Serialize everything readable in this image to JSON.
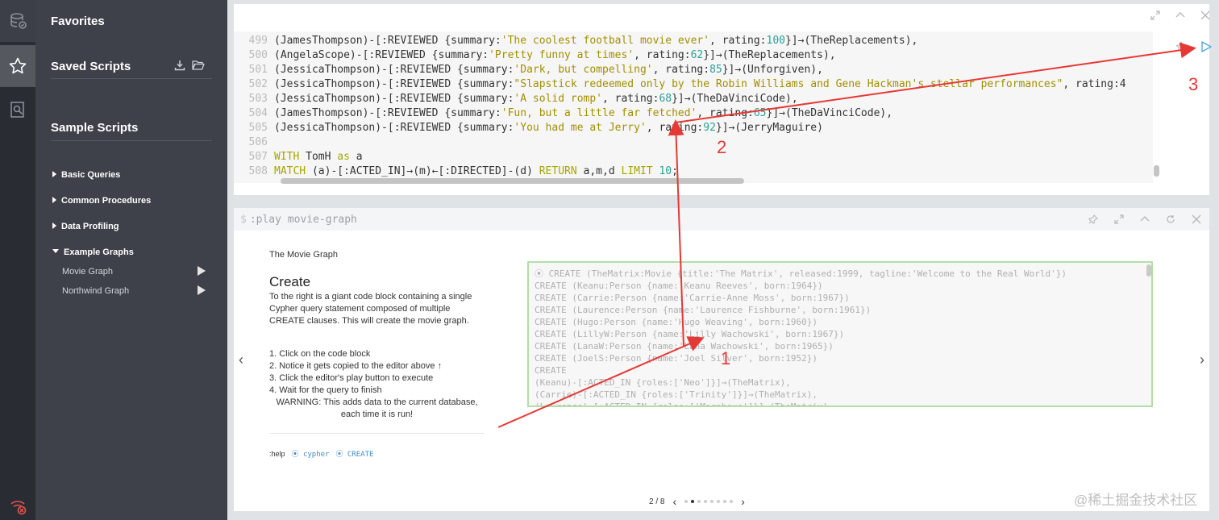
{
  "sidebar": {
    "favorites_title": "Favorites",
    "saved_scripts_title": "Saved Scripts",
    "sample_scripts_title": "Sample Scripts",
    "folders": [
      {
        "label": "Basic Queries"
      },
      {
        "label": "Common Procedures"
      },
      {
        "label": "Data Profiling"
      },
      {
        "label": "Example Graphs"
      }
    ],
    "example_graphs": [
      {
        "label": "Movie Graph"
      },
      {
        "label": "Northwind Graph"
      }
    ]
  },
  "editor": {
    "lines": [
      {
        "n": "499",
        "parts": [
          [
            "p",
            "(JamesThompson)-[:REVIEWED {summary:"
          ],
          [
            "s",
            "'The coolest football movie ever'"
          ],
          [
            "p",
            ", rating:"
          ],
          [
            "num",
            "100"
          ],
          [
            "p",
            "}]→(TheReplacements),"
          ]
        ]
      },
      {
        "n": "500",
        "parts": [
          [
            "p",
            "(AngelaScope)-[:REVIEWED {summary:"
          ],
          [
            "s",
            "'Pretty funny at times'"
          ],
          [
            "p",
            ", rating:"
          ],
          [
            "num",
            "62"
          ],
          [
            "p",
            "}]→(TheReplacements),"
          ]
        ]
      },
      {
        "n": "501",
        "parts": [
          [
            "p",
            "(JessicaThompson)-[:REVIEWED {summary:"
          ],
          [
            "s",
            "'Dark, but compelling'"
          ],
          [
            "p",
            ", rating:"
          ],
          [
            "num",
            "85"
          ],
          [
            "p",
            "}]→(Unforgiven),"
          ]
        ]
      },
      {
        "n": "502",
        "parts": [
          [
            "p",
            "(JessicaThompson)-[:REVIEWED {summary:"
          ],
          [
            "s",
            "\"Slapstick redeemed only by the Robin Williams and Gene Hackman's stellar performances\""
          ],
          [
            "p",
            ", rating:4"
          ]
        ]
      },
      {
        "n": "503",
        "parts": [
          [
            "p",
            "(JessicaThompson)-[:REVIEWED {summary:"
          ],
          [
            "s",
            "'A solid romp'"
          ],
          [
            "p",
            ", rating:"
          ],
          [
            "num",
            "68"
          ],
          [
            "p",
            "}]→(TheDaVinciCode),"
          ]
        ]
      },
      {
        "n": "504",
        "parts": [
          [
            "p",
            "(JamesThompson)-[:REVIEWED {summary:"
          ],
          [
            "s",
            "'Fun, but a little far fetched'"
          ],
          [
            "p",
            ", rating:"
          ],
          [
            "num",
            "65"
          ],
          [
            "p",
            "}]→(TheDaVinciCode),"
          ]
        ]
      },
      {
        "n": "505",
        "parts": [
          [
            "p",
            "(JessicaThompson)-[:REVIEWED {summary:"
          ],
          [
            "s",
            "'You had me at Jerry'"
          ],
          [
            "p",
            ", rating:"
          ],
          [
            "num",
            "92"
          ],
          [
            "p",
            "}]→(JerryMaguire)"
          ]
        ]
      },
      {
        "n": "506",
        "parts": []
      },
      {
        "n": "507",
        "parts": [
          [
            "k",
            "WITH"
          ],
          [
            "p",
            " TomH "
          ],
          [
            "k",
            "as"
          ],
          [
            "p",
            " a"
          ]
        ]
      },
      {
        "n": "508",
        "parts": [
          [
            "k",
            "MATCH"
          ],
          [
            "p",
            " (a)-[:ACTED_IN]→(m)←[:DIRECTED]-(d) "
          ],
          [
            "k",
            "RETURN"
          ],
          [
            "p",
            " a,m,d "
          ],
          [
            "k",
            "LIMIT"
          ],
          [
            "p",
            " "
          ],
          [
            "num",
            "10"
          ],
          [
            "p",
            ";"
          ]
        ]
      }
    ]
  },
  "frame": {
    "command": ":play movie-graph",
    "prompt": "$",
    "guide_title": "The Movie Graph",
    "heading": "Create",
    "description": "To the right is a giant code block containing a single Cypher query statement composed of multiple CREATE clauses. This will create the movie graph.",
    "steps": [
      "1. Click on the code block",
      "2. Notice it gets copied to the editor above ↑",
      "3. Click the editor's play button to execute",
      "4. Wait for the query to finish"
    ],
    "warning": "WARNING: This adds data to the current database, each time it is run!",
    "help_prefix": ":help",
    "help_links": [
      "cypher",
      "CREATE"
    ],
    "code_lines": [
      "CREATE (TheMatrix:Movie {title:'The Matrix', released:1999, tagline:'Welcome to the Real World'})",
      "CREATE (Keanu:Person {name:'Keanu Reeves', born:1964})",
      "CREATE (Carrie:Person {name:'Carrie-Anne Moss', born:1967})",
      "CREATE (Laurence:Person {name:'Laurence Fishburne', born:1961})",
      "CREATE (Hugo:Person {name:'Hugo Weaving', born:1960})",
      "CREATE (LillyW:Person {name:'Lilly Wachowski', born:1967})",
      "CREATE (LanaW:Person {name:'Lana Wachowski', born:1965})",
      "CREATE (JoelS:Person {name:'Joel Silver', born:1952})",
      "CREATE",
      "(Keanu)-[:ACTED_IN {roles:['Neo']}]→(TheMatrix),",
      "(Carrie)-[:ACTED_IN {roles:['Trinity']}]→(TheMatrix),",
      "(Laurence)-[:ACTED_IN {roles:['Morpheus']}]→(TheMatrix),"
    ],
    "pager": "2 / 8",
    "page_count": 8,
    "current_page": 2
  },
  "annotations": {
    "one": "1",
    "two": "2",
    "three": "3"
  },
  "watermark": "@稀土掘金技术社区",
  "colors": {
    "annotation": "#e53935",
    "code_block_border": "#b3dea6",
    "play_button": "#4fa8e6"
  }
}
